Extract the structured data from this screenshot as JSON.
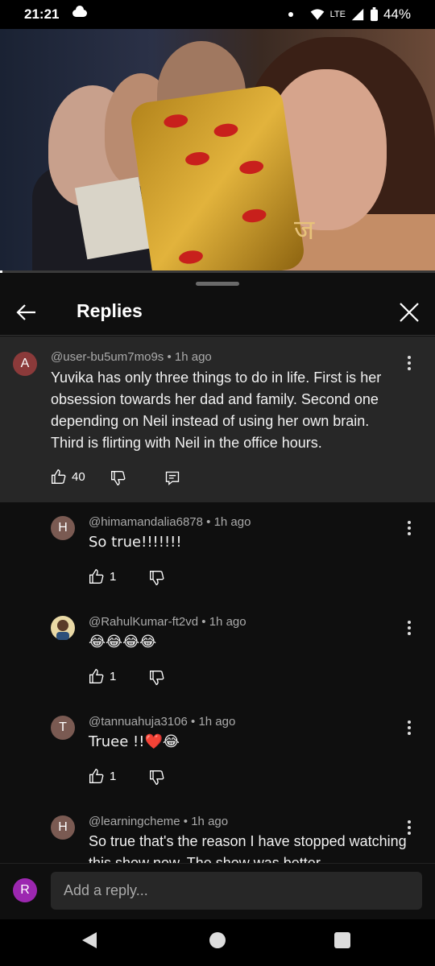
{
  "status_bar": {
    "time": "21:21",
    "network": "LTE",
    "battery": "44%"
  },
  "video": {
    "label": "ज"
  },
  "header": {
    "title": "Replies"
  },
  "parent_comment": {
    "avatar_letter": "A",
    "avatar_color": "#8b3a3a",
    "author": "@user-bu5um7mo9s",
    "time": "1h ago",
    "text": "Yuvika has only three things to do in life. First is her obsession towards her dad and family. Second one depending on Neil instead of using her own brain. Third is flirting with Neil in the office hours.",
    "likes": "40"
  },
  "replies": [
    {
      "avatar_letter": "H",
      "avatar_color": "#7a5a52",
      "author": "@himamandalia6878",
      "time": "1h ago",
      "text": "So true!!!!!!!",
      "likes": "1"
    },
    {
      "avatar_letter": "",
      "avatar_color": "#e9d9a6",
      "author": "@RahulKumar-ft2vd",
      "time": "1h ago",
      "text": "😂😂😂😂",
      "likes": "1"
    },
    {
      "avatar_letter": "T",
      "avatar_color": "#7a5a52",
      "author": "@tannuahuja3106",
      "time": "1h ago",
      "text": "Truee !!❤️😂",
      "likes": "1"
    },
    {
      "avatar_letter": "H",
      "avatar_color": "#7a5a52",
      "author": "@learningcheme",
      "time": "1h ago",
      "text": "So true that's the reason I have stopped watching this show now. The show was better",
      "likes": ""
    }
  ],
  "reply_input": {
    "avatar_letter": "R",
    "avatar_color": "#9c27b0",
    "placeholder": "Add a reply..."
  }
}
